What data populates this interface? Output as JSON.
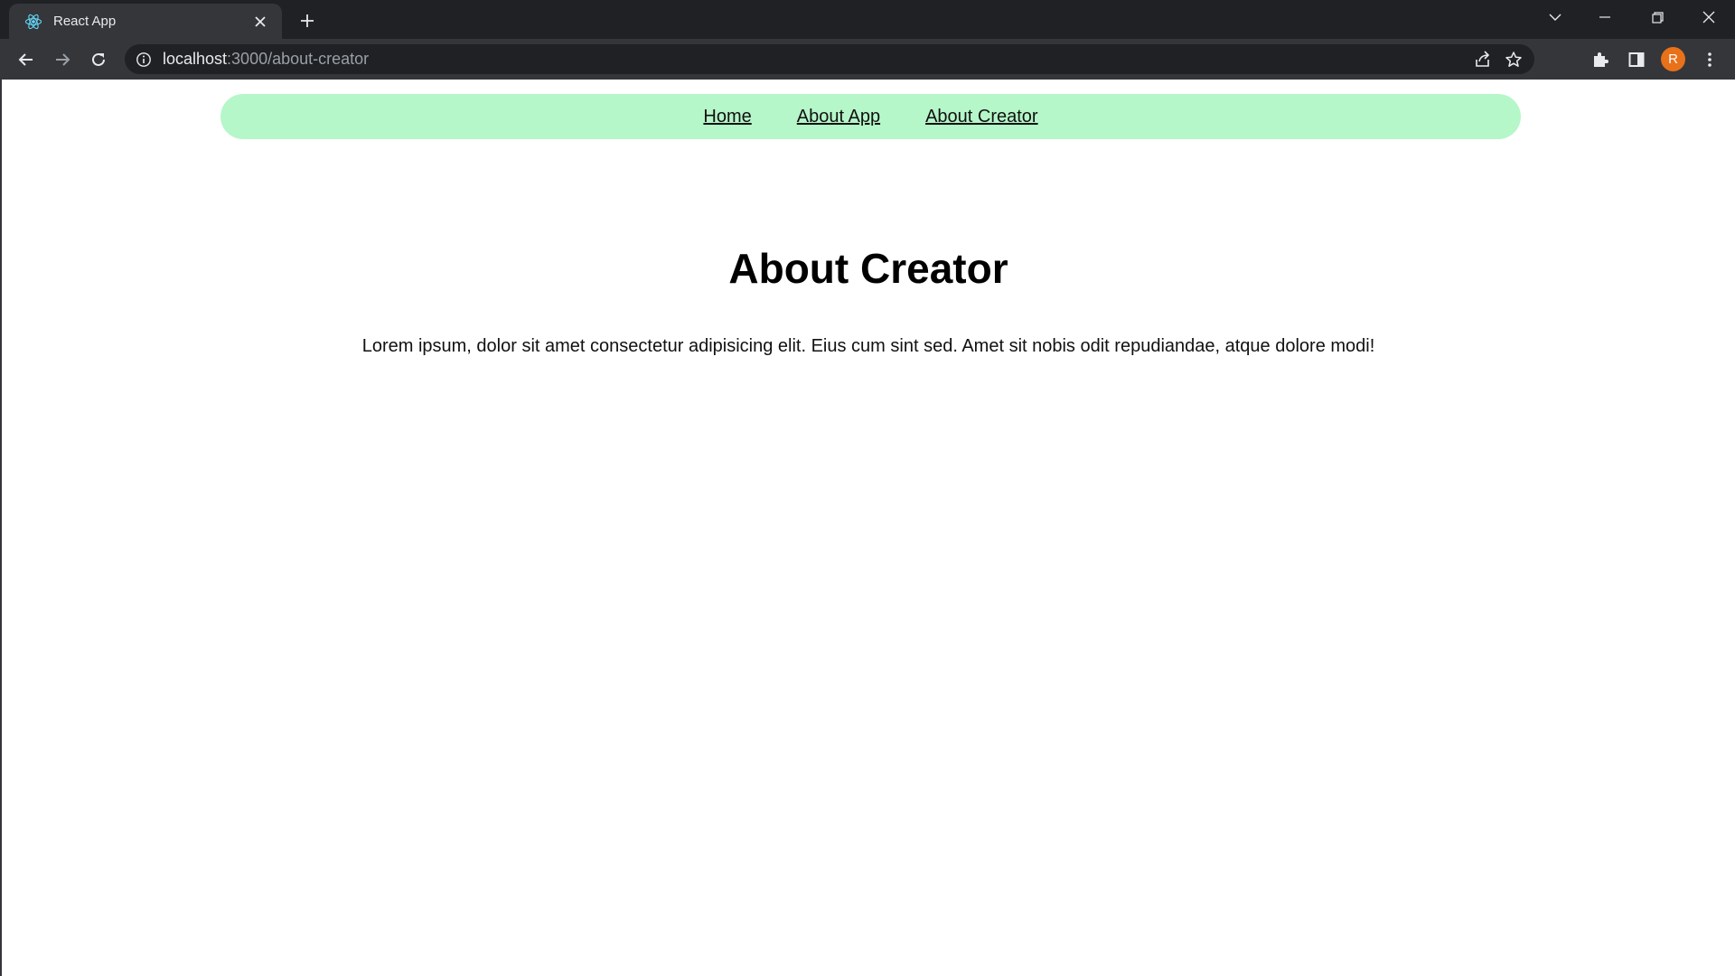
{
  "browser": {
    "tab": {
      "title": "React App",
      "favicon": "react-icon"
    },
    "omnibox": {
      "host": "localhost",
      "path": ":3000/about-creator"
    },
    "profile_initial": "R",
    "profile_color": "#e8711a"
  },
  "nav": {
    "background": "#b5f7c9",
    "links": [
      {
        "label": "Home"
      },
      {
        "label": "About App"
      },
      {
        "label": "About Creator"
      }
    ]
  },
  "main": {
    "title": "About Creator",
    "body": "Lorem ipsum, dolor sit amet consectetur adipisicing elit. Eius cum sint sed. Amet sit nobis odit repudiandae, atque dolore modi!"
  }
}
